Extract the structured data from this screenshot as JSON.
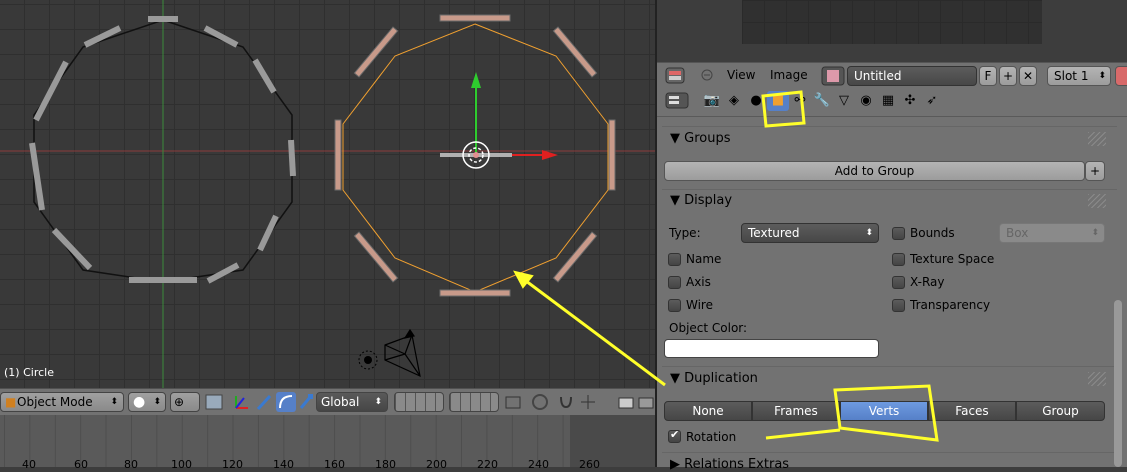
{
  "viewport": {
    "object_label": "(1) Circle"
  },
  "view3d_header": {
    "mode": "Object Mode",
    "orientation": "Global"
  },
  "timeline": {
    "ticks": [
      "40",
      "60",
      "80",
      "100",
      "120",
      "140",
      "160",
      "180",
      "200",
      "220",
      "240",
      "260"
    ]
  },
  "image_header": {
    "view_menu": "View",
    "image_menu": "Image",
    "image_name": "Untitled",
    "fake_user": "F",
    "slot": "Slot 1"
  },
  "groups_panel": {
    "title": "Groups",
    "add_button": "Add to Group",
    "add_icon": "+"
  },
  "display_panel": {
    "title": "Display",
    "type_label": "Type:",
    "type_value": "Textured",
    "bounds_label": "Bounds",
    "bounds_value": "Box",
    "options_left": [
      "Name",
      "Axis",
      "Wire"
    ],
    "options_right": [
      "Texture Space",
      "X-Ray",
      "Transparency"
    ],
    "object_color_label": "Object Color:",
    "object_color": "#ffffff"
  },
  "duplication_panel": {
    "title": "Duplication",
    "options": [
      "None",
      "Frames",
      "Verts",
      "Faces",
      "Group"
    ],
    "selected": "Verts",
    "rotation_label": "Rotation",
    "rotation_checked": true
  },
  "relations_panel": {
    "title": "Relations Extras"
  },
  "colors": {
    "highlight_annotation": "#ffff2a",
    "active_tab": "#5680c8",
    "selection_orange": "#f0a030"
  }
}
